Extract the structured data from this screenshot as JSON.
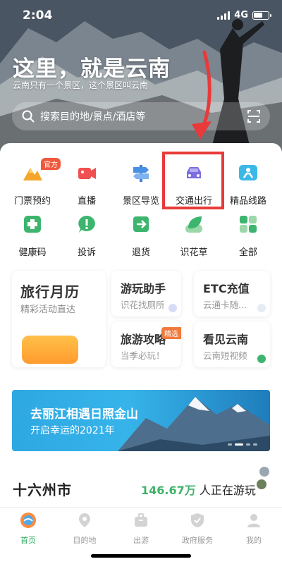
{
  "status": {
    "time": "2:04",
    "network": "4G"
  },
  "hero": {
    "title": "这里，就是云南",
    "subtitle": "云南只有一个景区，这个景区叫云南",
    "search_placeholder": "搜索目的地/景点/酒店等"
  },
  "services": [
    {
      "label": "门票预约",
      "icon": "mountain-ticket-icon",
      "badge": "官方"
    },
    {
      "label": "直播",
      "icon": "video-camera-icon"
    },
    {
      "label": "景区导览",
      "icon": "guide-signpost-icon"
    },
    {
      "label": "交通出行",
      "icon": "car-icon"
    },
    {
      "label": "精品线路",
      "icon": "route-icon"
    },
    {
      "label": "健康码",
      "icon": "health-code-icon"
    },
    {
      "label": "投诉",
      "icon": "complaint-icon"
    },
    {
      "label": "退货",
      "icon": "return-icon"
    },
    {
      "label": "识花草",
      "icon": "leaf-icon"
    },
    {
      "label": "全部",
      "icon": "all-grid-icon"
    }
  ],
  "features": {
    "calendar": {
      "title": "旅行月历",
      "subtitle": "精彩活动直达"
    },
    "helper": {
      "title": "游玩助手",
      "subtitle": "识花找厕所"
    },
    "etc": {
      "title": "ETC充值",
      "subtitle": "云通卡随..."
    },
    "guide": {
      "title": "旅游攻略",
      "subtitle": "当季必玩！",
      "tag": "精选"
    },
    "video": {
      "title": "看见云南",
      "subtitle": "云南短视频"
    }
  },
  "banner": {
    "title": "去丽江相遇日照金山",
    "subtitle": "开启幸运的2021年"
  },
  "stats": {
    "region_title": "十六州市",
    "count": "146.67万",
    "suffix": "人正在游玩"
  },
  "tabs": [
    {
      "label": "首页",
      "icon": "home-icon",
      "active": true
    },
    {
      "label": "目的地",
      "icon": "location-icon"
    },
    {
      "label": "出游",
      "icon": "suitcase-icon"
    },
    {
      "label": "政府服务",
      "icon": "shield-icon"
    },
    {
      "label": "我的",
      "icon": "person-icon"
    }
  ],
  "colors": {
    "accent": "#2dab5f",
    "highlight": "#e83a3a",
    "badge": "#f05a3c"
  }
}
